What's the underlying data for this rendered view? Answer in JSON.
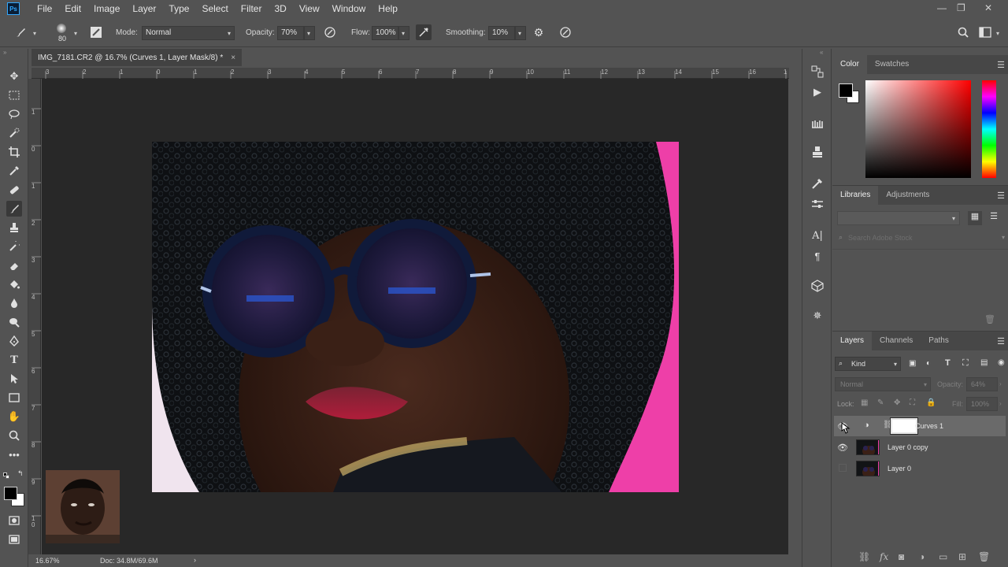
{
  "app": {
    "logo_text": "Ps"
  },
  "menu": [
    "File",
    "Edit",
    "Image",
    "Layer",
    "Type",
    "Select",
    "Filter",
    "3D",
    "View",
    "Window",
    "Help"
  ],
  "window_controls": {
    "minimize": "—",
    "restore": "❐",
    "close": "✕"
  },
  "options": {
    "brush_size": "80",
    "mode_label": "Mode:",
    "mode_value": "Normal",
    "opacity_label": "Opacity:",
    "opacity_value": "70%",
    "flow_label": "Flow:",
    "flow_value": "100%",
    "smoothing_label": "Smoothing:",
    "smoothing_value": "10%"
  },
  "document": {
    "tab_title": "IMG_7181.CR2 @ 16.7% (Curves 1, Layer Mask/8) *",
    "close_glyph": "×"
  },
  "rulers": {
    "top": [
      "3",
      "1",
      "2",
      "1",
      "0",
      "1",
      "2",
      "3",
      "4",
      "5",
      "6",
      "7",
      "8",
      "9",
      "10",
      "11",
      "12",
      "13",
      "14",
      "15",
      "16",
      "1"
    ],
    "left": [
      "1",
      "0",
      "1",
      "2",
      "3",
      "4",
      "5",
      "6",
      "7",
      "8",
      "9",
      "1\n0"
    ]
  },
  "status": {
    "zoom": "16.67%",
    "doc": "Doc: 34.8M/69.6M",
    "arrow": "›"
  },
  "color_panel": {
    "tabs": [
      "Color",
      "Swatches"
    ],
    "active": "Color"
  },
  "libraries_panel": {
    "tabs": [
      "Libraries",
      "Adjustments"
    ],
    "active": "Libraries",
    "search_placeholder": "Search Adobe Stock"
  },
  "layers_panel": {
    "tabs": [
      "Layers",
      "Channels",
      "Paths"
    ],
    "active": "Layers",
    "kind_label": "Kind",
    "blend_mode": "Normal",
    "opacity_label": "Opacity:",
    "opacity_value": "64%",
    "lock_label": "Lock:",
    "fill_label": "Fill:",
    "fill_value": "100%",
    "layers": [
      {
        "name": "Curves 1",
        "visible": true,
        "selected": true,
        "type": "adjustment"
      },
      {
        "name": "Layer 0 copy",
        "visible": true,
        "selected": false,
        "type": "pixel"
      },
      {
        "name": "Layer 0",
        "visible": false,
        "selected": false,
        "type": "pixel"
      }
    ]
  },
  "colors": {
    "ui_bg": "#535353",
    "canvas_bg": "#282828",
    "photo_bg": "#ee3fa8",
    "accent": "#31a8ff",
    "foreground": "#000000",
    "background": "#ffffff"
  }
}
